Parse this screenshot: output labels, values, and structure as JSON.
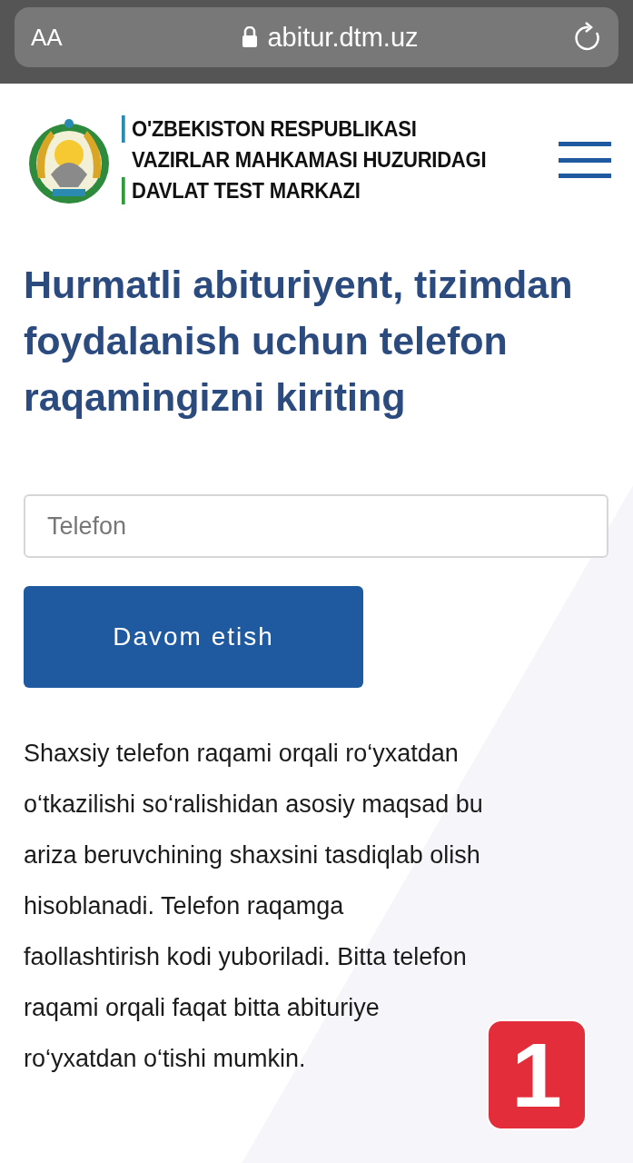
{
  "browser_bar": {
    "text_size_button": "AA",
    "url": "abitur.dtm.uz"
  },
  "header": {
    "title_lines": [
      "O'ZBEKISTON RESPUBLIKASI",
      "VAZIRLAR MAHKAMASI HUZURIDAGI",
      "DAVLAT TEST MARKAZI"
    ]
  },
  "heading": "Hurmatli abituriyent, tizimdan foydalanish uchun telefon raqamingizni kiriting",
  "phone_field": {
    "placeholder": "Telefon"
  },
  "continue_button": "Davom etish",
  "info_lines": [
    "Shaxsiy telefon raqami orqali ro‘yxatdan",
    "o‘tkazilishi so‘ralishidan asosiy maqsad bu",
    "ariza beruvchining shaxsini tasdiqlab olish",
    "hisoblanadi. Telefon raqamga",
    "faollashtirish kodi yuboriladi. Bitta telefon",
    "raqami orqali faqat bitta abituriye",
    "ro‘yxatdan o‘tishi mumkin."
  ],
  "badge": "1"
}
